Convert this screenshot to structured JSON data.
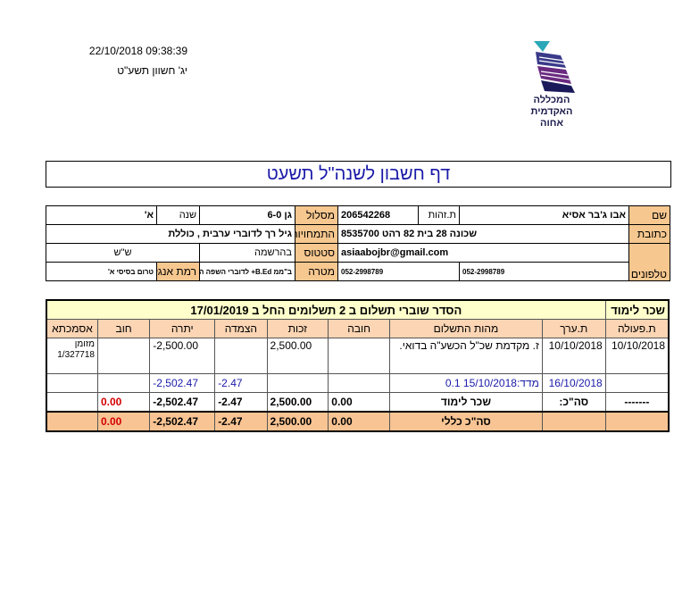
{
  "header": {
    "datetime": "22/10/2018 09:38:39",
    "hebrew_date": "יג' חשוון תשע\"ט",
    "logo_lines": [
      "המכללה",
      "האקדמית",
      "אחוה"
    ]
  },
  "title": "דף חשבון לשנה\"ל תשעט",
  "info": {
    "name_label": "שם",
    "name_value": "אבו ג'בר אסיא",
    "id_label": "ת.זהות",
    "id_value": "206542268",
    "track_label": "מסלול",
    "track_value": "גן 6-0",
    "year_label": "שנה",
    "year_value": "א'",
    "address_label": "כתובת",
    "address_line1": "שכונה 28 בית 82 רהט 8535700",
    "address_line2": "asiaabojbr@gmail.com",
    "specialization_label": "התמחויות",
    "specialization_value": "גיל רך לדוברי ערבית , כוללת",
    "status_label": "סטטוס",
    "status_value": "בהרשמה",
    "status_extra": "ש\"ש",
    "phones_label": "טלפונים",
    "phone1": "052-2998789",
    "phone2": "052-2998789",
    "goal_label": "מטרה",
    "goal_value": "ב\"ממ B.Ed+ לדוברי השפה הערב",
    "english_label": "רמת אנגלית",
    "english_value": "טרום בסיסי א'"
  },
  "payment": {
    "section_label": "שכר לימוד",
    "arrangement": "הסדר שוברי תשלום ב 2 תשלומים החל ב 17/01/2019",
    "columns": [
      "ת.פעולה",
      "ת.ערך",
      "מהות התשלום",
      "חובה",
      "זכות",
      "הצמדה",
      "יתרה",
      "חוב",
      "אסמכתא"
    ],
    "rows": [
      {
        "action_date": "10/10/2018",
        "value_date": "10/10/2018",
        "description": "ז. מקדמת שכ\"ל הכשע\"ה בדואי.",
        "debit": "",
        "credit": "2,500.00",
        "linkage": "",
        "balance": "-2,500.00",
        "debt": "",
        "reference": "מזומן 1/327718"
      },
      {
        "action_date": "",
        "value_date": "16/10/2018",
        "description": "מדד:15/10/2018 0.1",
        "debit": "",
        "credit": "",
        "linkage": "-2.47",
        "balance": "-2,502.47",
        "debt": "",
        "reference": ""
      }
    ],
    "subtotal": {
      "action_date": "-------",
      "value_date": "סה\"כ:",
      "description": "שכר לימוד",
      "debit": "0.00",
      "credit": "2,500.00",
      "linkage": "-2.47",
      "balance": "-2,502.47",
      "debt": "0.00"
    },
    "grand_total": {
      "label": "סה\"כ כללי",
      "debit": "0.00",
      "credit": "2,500.00",
      "linkage": "-2.47",
      "balance": "-2,502.47",
      "debt": "0.00"
    }
  },
  "colors": {
    "label_bg": "#f6c78f",
    "header_bg": "#fcd5b4",
    "title_color": "#1a1aa8",
    "red": "#d40000"
  }
}
